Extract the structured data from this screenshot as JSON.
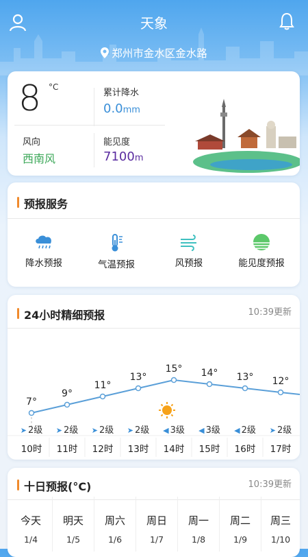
{
  "header": {
    "title": "天象",
    "location": "郑州市金水区金水路"
  },
  "current": {
    "temperature": "8",
    "temp_unit": "°C",
    "precip_label": "累计降水",
    "precip_value": "0.0",
    "precip_unit": "mm",
    "wind_label": "风向",
    "wind_value": "西南风",
    "visibility_label": "能见度",
    "visibility_value": "7100",
    "visibility_unit": "m"
  },
  "forecast_services": {
    "title": "预报服务",
    "items": [
      {
        "label": "降水预报",
        "icon": "rain-cloud-icon"
      },
      {
        "label": "气温预报",
        "icon": "thermometer-icon"
      },
      {
        "label": "风预报",
        "icon": "wind-icon"
      },
      {
        "label": "能见度预报",
        "icon": "visibility-icon"
      }
    ]
  },
  "hourly": {
    "title": "24小时精细预报",
    "updated": "10:39更新",
    "temps": [
      "7°",
      "9°",
      "11°",
      "13°",
      "15°",
      "14°",
      "13°",
      "12°"
    ],
    "winds": [
      "2级",
      "2级",
      "2级",
      "2级",
      "3级",
      "3级",
      "2级",
      "2级"
    ],
    "hours": [
      "10时",
      "11时",
      "12时",
      "13时",
      "14时",
      "15时",
      "16时",
      "17时"
    ],
    "weather_icon": "sun-icon"
  },
  "chart_data": {
    "type": "line",
    "x": [
      "10时",
      "11时",
      "12时",
      "13时",
      "14时",
      "15时",
      "16时",
      "17时"
    ],
    "series": [
      {
        "values": [
          7,
          9,
          11,
          13,
          15,
          14,
          13,
          12
        ]
      }
    ],
    "xlabel": "",
    "ylabel": ""
  },
  "ten_day": {
    "title": "十日预报(°C)",
    "updated": "10:39更新",
    "days": [
      {
        "name": "今天",
        "date": "1/4"
      },
      {
        "name": "明天",
        "date": "1/5"
      },
      {
        "name": "周六",
        "date": "1/6"
      },
      {
        "name": "周日",
        "date": "1/7"
      },
      {
        "name": "周一",
        "date": "1/8"
      },
      {
        "name": "周二",
        "date": "1/9"
      },
      {
        "name": "周三",
        "date": "1/10"
      }
    ]
  },
  "colors": {
    "accent": "#3a8fd8",
    "title_bar": "#f08a2c",
    "wind_green": "#3aa757",
    "vis_purple": "#5a2ca0"
  }
}
